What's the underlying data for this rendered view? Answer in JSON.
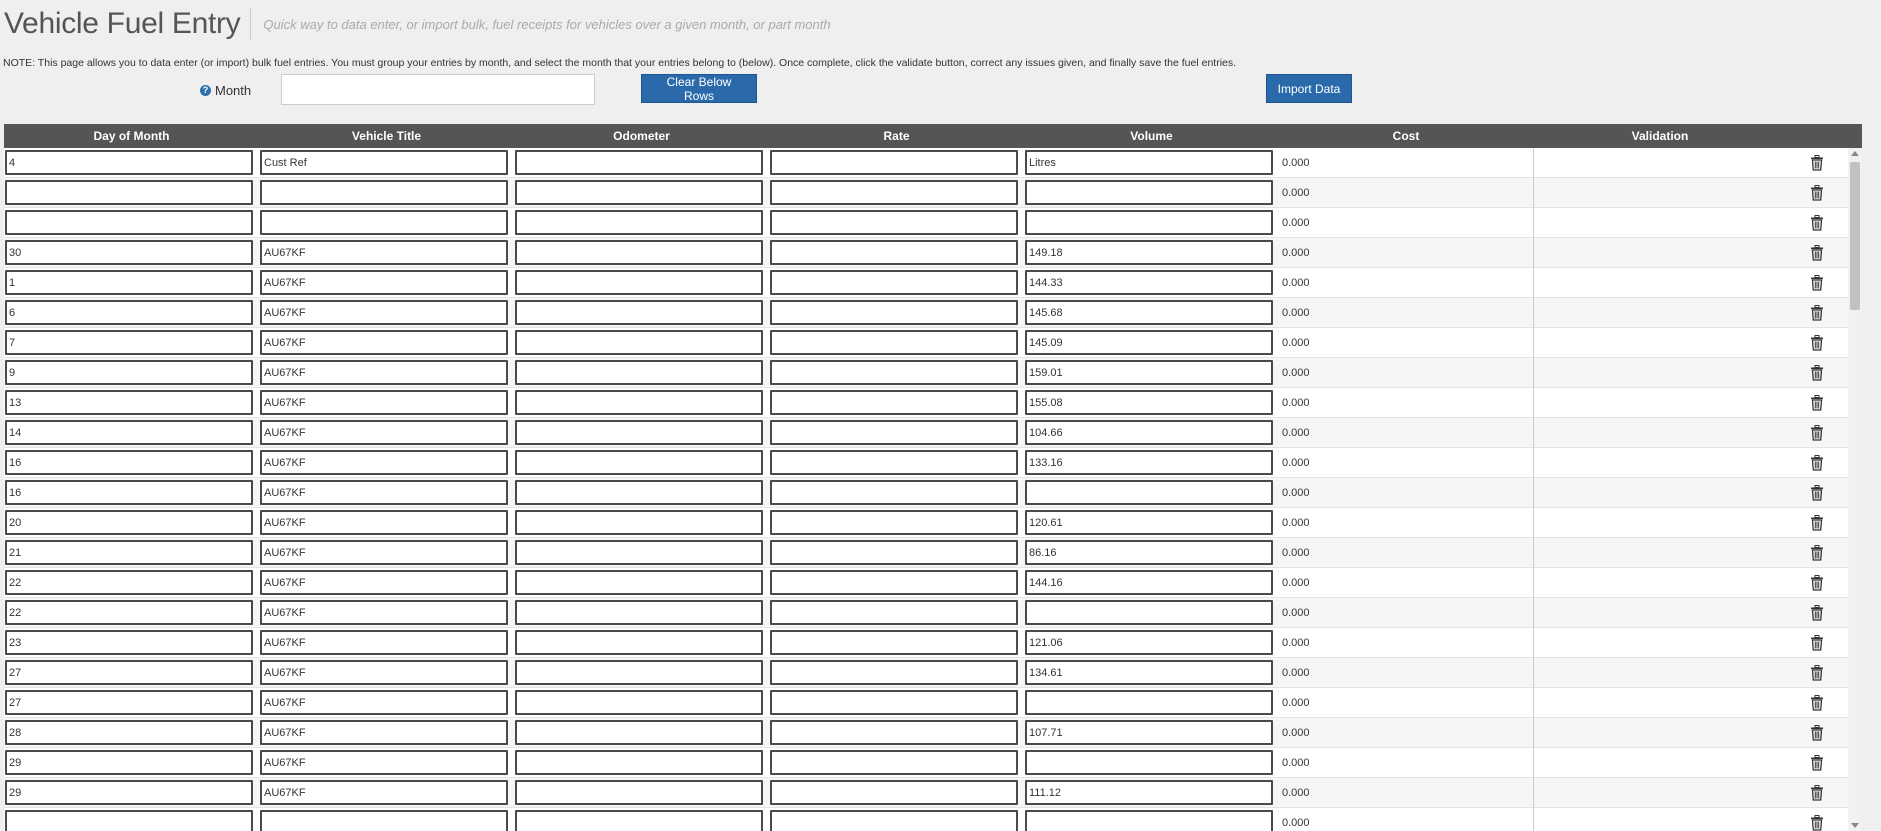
{
  "header": {
    "title": "Vehicle Fuel Entry",
    "subtitle": "Quick way to data enter, or import bulk, fuel receipts for vehicles over a given month, or part month"
  },
  "note": "NOTE: This page allows you to data enter (or import) bulk fuel entries. You must group your entries by month, and select the month that your entries belong to (below). Once complete, click the validate button, correct any issues given, and finally save the fuel entries.",
  "month": {
    "label": "Month",
    "help_icon": "question-circle-icon",
    "value": ""
  },
  "buttons": {
    "clear": "Clear Below Rows",
    "import": "Import Data"
  },
  "grid": {
    "columns": [
      "Day of Month",
      "Vehicle Title",
      "Odometer",
      "Rate",
      "Volume",
      "Cost",
      "Validation"
    ],
    "delete_icon": "trash-icon",
    "rows": [
      {
        "day": "4",
        "vehicle": "Cust Ref",
        "odometer": "",
        "rate": "",
        "volume": "Litres",
        "cost": "0.000",
        "validation": ""
      },
      {
        "day": "",
        "vehicle": "",
        "odometer": "",
        "rate": "",
        "volume": "",
        "cost": "0.000",
        "validation": ""
      },
      {
        "day": "",
        "vehicle": "",
        "odometer": "",
        "rate": "",
        "volume": "",
        "cost": "0.000",
        "validation": ""
      },
      {
        "day": "30",
        "vehicle": "AU67KF",
        "odometer": "",
        "rate": "",
        "volume": "149.18",
        "cost": "0.000",
        "validation": ""
      },
      {
        "day": "1",
        "vehicle": "AU67KF",
        "odometer": "",
        "rate": "",
        "volume": "144.33",
        "cost": "0.000",
        "validation": ""
      },
      {
        "day": "6",
        "vehicle": "AU67KF",
        "odometer": "",
        "rate": "",
        "volume": "145.68",
        "cost": "0.000",
        "validation": ""
      },
      {
        "day": "7",
        "vehicle": "AU67KF",
        "odometer": "",
        "rate": "",
        "volume": "145.09",
        "cost": "0.000",
        "validation": ""
      },
      {
        "day": "9",
        "vehicle": "AU67KF",
        "odometer": "",
        "rate": "",
        "volume": "159.01",
        "cost": "0.000",
        "validation": ""
      },
      {
        "day": "13",
        "vehicle": "AU67KF",
        "odometer": "",
        "rate": "",
        "volume": "155.08",
        "cost": "0.000",
        "validation": ""
      },
      {
        "day": "14",
        "vehicle": "AU67KF",
        "odometer": "",
        "rate": "",
        "volume": "104.66",
        "cost": "0.000",
        "validation": ""
      },
      {
        "day": "16",
        "vehicle": "AU67KF",
        "odometer": "",
        "rate": "",
        "volume": "133.16",
        "cost": "0.000",
        "validation": ""
      },
      {
        "day": "16",
        "vehicle": "AU67KF",
        "odometer": "",
        "rate": "",
        "volume": "",
        "cost": "0.000",
        "validation": ""
      },
      {
        "day": "20",
        "vehicle": "AU67KF",
        "odometer": "",
        "rate": "",
        "volume": "120.61",
        "cost": "0.000",
        "validation": ""
      },
      {
        "day": "21",
        "vehicle": "AU67KF",
        "odometer": "",
        "rate": "",
        "volume": "86.16",
        "cost": "0.000",
        "validation": ""
      },
      {
        "day": "22",
        "vehicle": "AU67KF",
        "odometer": "",
        "rate": "",
        "volume": "144.16",
        "cost": "0.000",
        "validation": ""
      },
      {
        "day": "22",
        "vehicle": "AU67KF",
        "odometer": "",
        "rate": "",
        "volume": "",
        "cost": "0.000",
        "validation": ""
      },
      {
        "day": "23",
        "vehicle": "AU67KF",
        "odometer": "",
        "rate": "",
        "volume": "121.06",
        "cost": "0.000",
        "validation": ""
      },
      {
        "day": "27",
        "vehicle": "AU67KF",
        "odometer": "",
        "rate": "",
        "volume": "134.61",
        "cost": "0.000",
        "validation": ""
      },
      {
        "day": "27",
        "vehicle": "AU67KF",
        "odometer": "",
        "rate": "",
        "volume": "",
        "cost": "0.000",
        "validation": ""
      },
      {
        "day": "28",
        "vehicle": "AU67KF",
        "odometer": "",
        "rate": "",
        "volume": "107.71",
        "cost": "0.000",
        "validation": ""
      },
      {
        "day": "29",
        "vehicle": "AU67KF",
        "odometer": "",
        "rate": "",
        "volume": "",
        "cost": "0.000",
        "validation": ""
      },
      {
        "day": "29",
        "vehicle": "AU67KF",
        "odometer": "",
        "rate": "",
        "volume": "111.12",
        "cost": "0.000",
        "validation": ""
      },
      {
        "day": "",
        "vehicle": "",
        "odometer": "",
        "rate": "",
        "volume": "",
        "cost": "0.000",
        "validation": ""
      }
    ]
  }
}
